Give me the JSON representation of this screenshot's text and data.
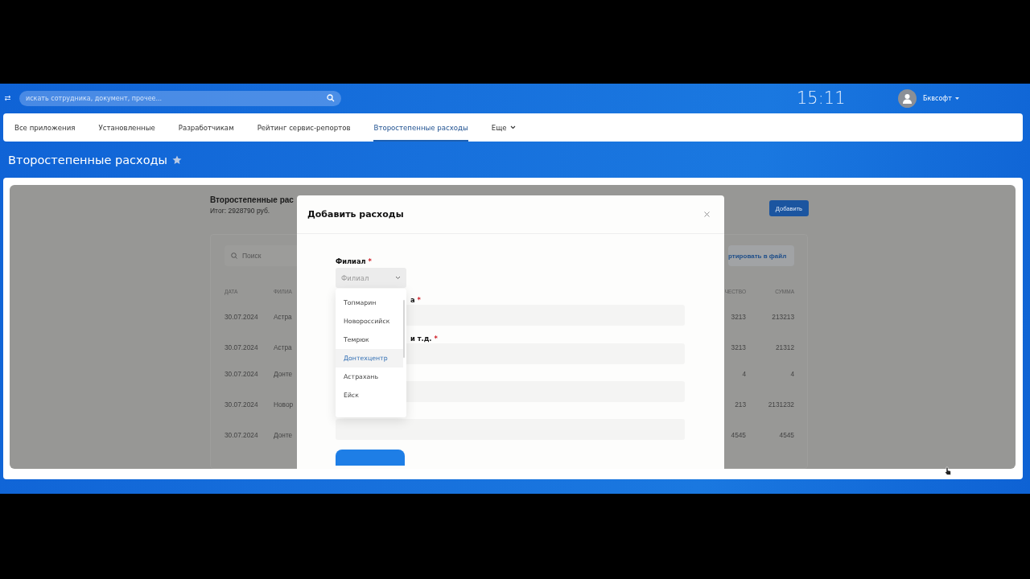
{
  "topbar": {
    "search": {
      "placeholder": "искать сотрудника, документ, прочее..."
    },
    "clock": "15:11",
    "user": "Бквсофт"
  },
  "nav": {
    "items": [
      {
        "label": "Все приложения",
        "selected": false
      },
      {
        "label": "Установленные",
        "selected": false
      },
      {
        "label": "Разработчикам",
        "selected": false
      },
      {
        "label": "Рейтинг сервис-репортов",
        "selected": false
      },
      {
        "label": "Второстепенные расходы",
        "selected": true
      },
      {
        "label": "Еще",
        "selected": false,
        "kind": "more"
      }
    ]
  },
  "page_title": "Второстепенные расходы",
  "report": {
    "title": "Второстепенные рас",
    "total": "Итог: 2928790 руб.",
    "add_button": "Добавить",
    "search": {
      "placeholder": "Поиск"
    },
    "export_button": "ртировать в файл",
    "columns": [
      "ДАТА",
      "ФИЛИА",
      "ЧЕСТВО",
      "СУММА"
    ],
    "rows": [
      [
        "30.07.2024",
        "Астра",
        "3213",
        "213213"
      ],
      [
        "30.07.2024",
        "Астра",
        "3213",
        "21312"
      ],
      [
        "30.07.2024",
        "Донте",
        "4",
        "4"
      ],
      [
        "30.07.2024",
        "Новор",
        "213",
        "2131232"
      ],
      [
        "30.07.2024",
        "Донте",
        "4545",
        "4545"
      ]
    ]
  },
  "modal": {
    "title": "Добавить расходы",
    "branch": {
      "label": "Филиал",
      "required_mark": "*",
      "placeholder": "Филиал",
      "expanded": true,
      "options": [
        {
          "label": "Топмарин",
          "selected": false
        },
        {
          "label": "Новороссийск",
          "selected": false
        },
        {
          "label": "Темрюк",
          "selected": false
        },
        {
          "label": "Донтехцентр",
          "selected": true
        },
        {
          "label": "Астрахань",
          "selected": false
        },
        {
          "label": "Ейск",
          "selected": false
        }
      ]
    },
    "fields": [
      {
        "kind": "text",
        "label": "а",
        "required_mark": "*"
      },
      {
        "kind": "text",
        "label": "и т.д.",
        "required_mark": "*"
      },
      {
        "kind": "text"
      },
      {
        "kind": "text"
      }
    ]
  }
}
